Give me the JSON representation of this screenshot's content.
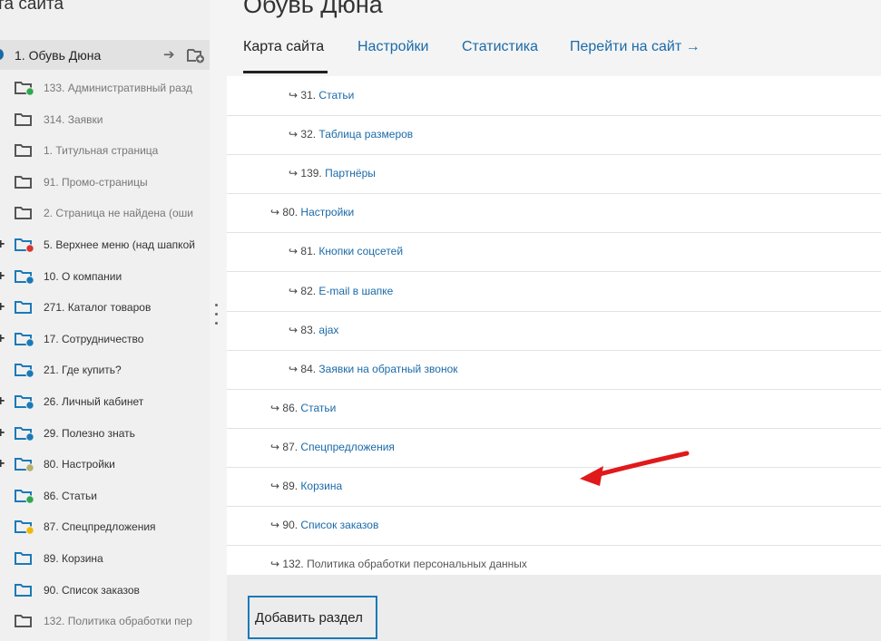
{
  "sidebar": {
    "title": "та сайта",
    "root": {
      "label": "1. Обувь Дюна",
      "arrow": "➔"
    },
    "items": [
      {
        "label": "133. Административный разд",
        "dot": "#2fa84f",
        "expandable": false,
        "active": false
      },
      {
        "label": "314. Заявки",
        "dot": null,
        "expandable": false,
        "active": false
      },
      {
        "label": "1. Титульная страница",
        "dot": null,
        "expandable": false,
        "active": false
      },
      {
        "label": "91. Промо-страницы",
        "dot": null,
        "expandable": false,
        "active": false
      },
      {
        "label": "2. Страница не найдена (оши",
        "dot": null,
        "expandable": false,
        "active": false
      },
      {
        "label": "5. Верхнее меню (над шапкой",
        "dot": "#d9342b",
        "expandable": true,
        "active": true
      },
      {
        "label": "10. О компании",
        "dot": "#1a7ab8",
        "expandable": true,
        "active": true
      },
      {
        "label": "271. Каталог товаров",
        "dot": null,
        "expandable": true,
        "active": true
      },
      {
        "label": "17. Сотрудничество",
        "dot": "#1a7ab8",
        "expandable": true,
        "active": true
      },
      {
        "label": "21. Где купить?",
        "dot": "#1a7ab8",
        "expandable": false,
        "active": true
      },
      {
        "label": "26. Личный кабинет",
        "dot": "#1a7ab8",
        "expandable": true,
        "active": true
      },
      {
        "label": "29. Полезно знать",
        "dot": "#1a7ab8",
        "expandable": true,
        "active": true
      },
      {
        "label": "80. Настройки",
        "dot": "#b7b06a",
        "expandable": true,
        "active": true
      },
      {
        "label": "86. Статьи",
        "dot": "#2fa84f",
        "expandable": false,
        "active": true
      },
      {
        "label": "87. Спецпредложения",
        "dot": "#f0b800",
        "expandable": false,
        "active": true
      },
      {
        "label": "89. Корзина",
        "dot": null,
        "expandable": false,
        "active": true
      },
      {
        "label": "90. Список заказов",
        "dot": null,
        "expandable": false,
        "active": true
      },
      {
        "label": "132. Политика обработки пер",
        "dot": null,
        "expandable": false,
        "active": false
      }
    ]
  },
  "main": {
    "title": "Обувь Дюна",
    "tabs": [
      {
        "label": "Карта сайта",
        "active": true
      },
      {
        "label": "Настройки",
        "active": false
      },
      {
        "label": "Статистика",
        "active": false
      },
      {
        "label": "Перейти на сайт →",
        "active": false
      }
    ],
    "rows": [
      {
        "prefix": "↪ 31.",
        "name": "Статьи",
        "level": 2,
        "link": true
      },
      {
        "prefix": "↪ 32.",
        "name": "Таблица размеров",
        "level": 2,
        "link": true
      },
      {
        "prefix": "↪ 139.",
        "name": "Партнёры",
        "level": 2,
        "link": true
      },
      {
        "prefix": "↪ 80.",
        "name": "Настройки",
        "level": 1,
        "link": true
      },
      {
        "prefix": "↪ 81.",
        "name": "Кнопки соцсетей",
        "level": 2,
        "link": true
      },
      {
        "prefix": "↪ 82.",
        "name": "E-mail в шапке",
        "level": 2,
        "link": true
      },
      {
        "prefix": "↪ 83.",
        "name": "ajax",
        "level": 2,
        "link": true
      },
      {
        "prefix": "↪ 84.",
        "name": "Заявки на обратный звонок",
        "level": 2,
        "link": true
      },
      {
        "prefix": "↪ 86.",
        "name": "Статьи",
        "level": 1,
        "link": true
      },
      {
        "prefix": "↪ 87.",
        "name": "Спецпредложения",
        "level": 1,
        "link": true
      },
      {
        "prefix": "↪ 89.",
        "name": "Корзина",
        "level": 1,
        "link": true
      },
      {
        "prefix": "↪ 90.",
        "name": "Список заказов",
        "level": 1,
        "link": true
      },
      {
        "prefix": "↪ 132.",
        "name": "Политика обработки персональных данных",
        "level": 1,
        "link": false
      }
    ],
    "add_button": "Добавить раздел"
  },
  "colors": {
    "link": "#1a6aa8",
    "folder": "#1a7ab8",
    "folder_muted": "#555555",
    "annotation_arrow": "#e0191b"
  }
}
